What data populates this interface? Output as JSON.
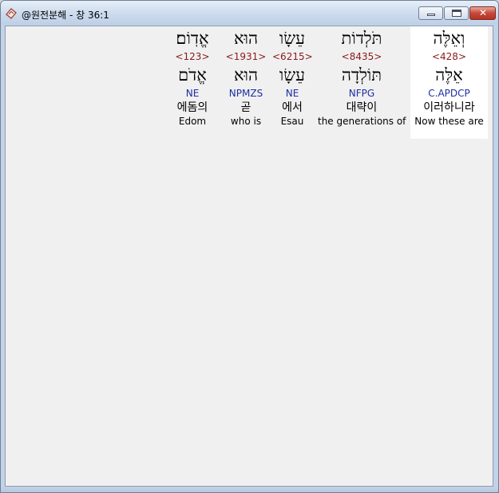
{
  "window": {
    "title": "@원전분해 - 창 36:1",
    "close_glyph": "✕"
  },
  "words": [
    {
      "hebrew": "וְאֵלֶּה",
      "strong": "<428>",
      "lemma": "אֵלֶּה",
      "morph": "C.APDCP",
      "korean": "이러하니라",
      "english": "Now these are",
      "selected": true
    },
    {
      "hebrew": "תֹּלְדוֹת",
      "strong": "<8435>",
      "lemma": "תּוֹלְדָה",
      "morph": "NFPG",
      "korean": "대략이",
      "english": "the generations of",
      "selected": false
    },
    {
      "hebrew": "עֵשָׂו",
      "strong": "<6215>",
      "lemma": "עֵשָׂו",
      "morph": "NE",
      "korean": "에서",
      "english": "Esau",
      "selected": false
    },
    {
      "hebrew": "הוּא",
      "strong": "<1931>",
      "lemma": "הוּא",
      "morph": "NPMZS",
      "korean": "곧",
      "english": "who is",
      "selected": false
    },
    {
      "hebrew": "אֱדֽוֹם׃",
      "strong": "<123>",
      "lemma": "אֱדֹם",
      "morph": "NE",
      "korean": "에돔의",
      "english": "Edom",
      "selected": false
    }
  ]
}
